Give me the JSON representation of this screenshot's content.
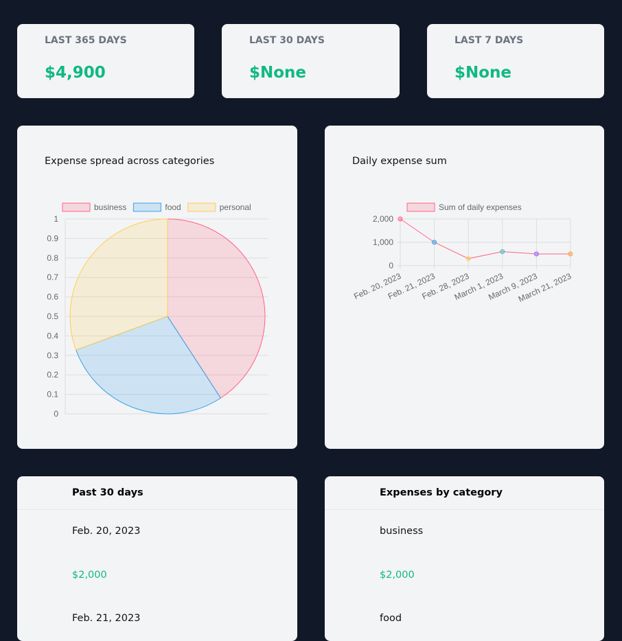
{
  "stats": [
    {
      "label": "LAST 365 DAYS",
      "value": "$4,900"
    },
    {
      "label": "LAST 30 DAYS",
      "value": "$None"
    },
    {
      "label": "LAST 7 DAYS",
      "value": "$None"
    }
  ],
  "colors": {
    "background": "#111827",
    "card": "#f3f4f6",
    "accent": "#10b981",
    "label": "#6b7280"
  },
  "chart_data": [
    {
      "type": "pie",
      "title": "Expense spread across categories",
      "categories": [
        "business",
        "food",
        "personal"
      ],
      "values": [
        2000,
        1400,
        1500
      ],
      "colors": [
        "#ff6384",
        "#36a2eb",
        "#ffcd56"
      ],
      "legend": "top",
      "y_ticks": [
        "0",
        "0.1",
        "0.2",
        "0.3",
        "0.4",
        "0.5",
        "0.6",
        "0.7",
        "0.8",
        "0.9",
        "1"
      ],
      "grid": true
    },
    {
      "type": "line",
      "title": "Daily expense sum",
      "series": [
        {
          "name": "Sum of daily expenses",
          "values": [
            2000,
            1000,
            300,
            600,
            500,
            500
          ]
        }
      ],
      "categories": [
        "Feb. 20, 2023",
        "Feb. 21, 2023",
        "Feb. 28, 2023",
        "March 1, 2023",
        "March 9, 2023",
        "March 21, 2023"
      ],
      "point_colors": [
        "#ff6384",
        "#36a2eb",
        "#ffcd56",
        "#4bc0c0",
        "#9966ff",
        "#ff9f40"
      ],
      "y_ticks": [
        "0",
        "1,000",
        "2,000"
      ],
      "ylim": [
        0,
        2000
      ],
      "legend": "top",
      "grid": true
    }
  ],
  "tables": [
    {
      "header": "Past 30 days",
      "rows": [
        "Feb. 20, 2023",
        "$2,000",
        "Feb. 21, 2023"
      ]
    },
    {
      "header": "Expenses by category",
      "rows": [
        "business",
        "$2,000",
        "food"
      ]
    }
  ]
}
